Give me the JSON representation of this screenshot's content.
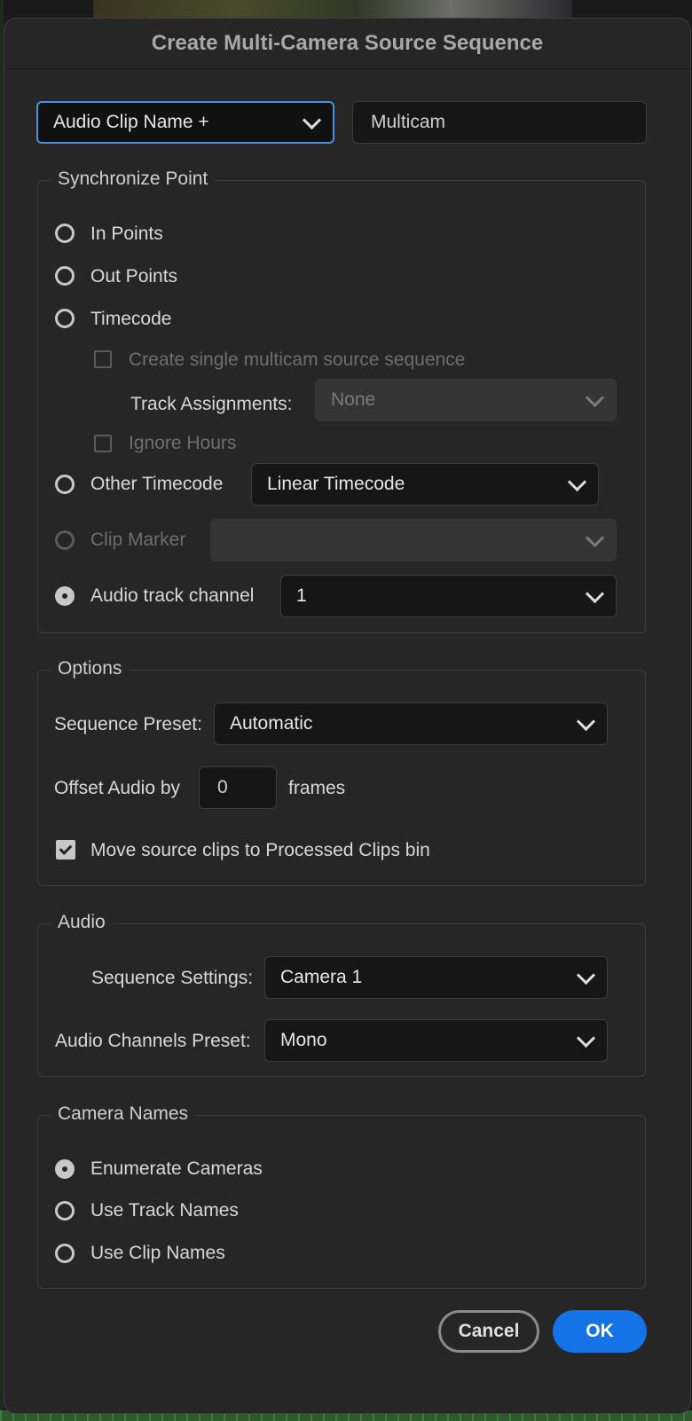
{
  "dialog": {
    "title": "Create Multi-Camera Source Sequence"
  },
  "header": {
    "name_mode_select": "Audio Clip Name +",
    "name_field": "Multicam"
  },
  "sync": {
    "legend": "Synchronize Point",
    "in_points": "In Points",
    "out_points": "Out Points",
    "timecode": "Timecode",
    "create_single": "Create single multicam source sequence",
    "track_assignments_label": "Track Assignments:",
    "track_assignments_value": "None",
    "ignore_hours": "Ignore Hours",
    "other_timecode": "Other Timecode",
    "other_timecode_value": "Linear Timecode",
    "clip_marker": "Clip Marker",
    "clip_marker_value": "",
    "audio_track_channel": "Audio track channel",
    "audio_track_channel_value": "1",
    "selected": "Audio track channel"
  },
  "options": {
    "legend": "Options",
    "sequence_preset_label": "Sequence Preset:",
    "sequence_preset_value": "Automatic",
    "offset_audio_label": "Offset Audio by",
    "offset_audio_value": "0",
    "frames_label": "frames",
    "move_clips_label": "Move source clips to Processed Clips bin",
    "move_clips_checked": true
  },
  "audio": {
    "legend": "Audio",
    "sequence_settings_label": "Sequence Settings:",
    "sequence_settings_value": "Camera 1",
    "channels_preset_label": "Audio Channels Preset:",
    "channels_preset_value": "Mono"
  },
  "camera_names": {
    "legend": "Camera Names",
    "enumerate": "Enumerate Cameras",
    "track_names": "Use Track Names",
    "clip_names": "Use Clip Names",
    "selected": "Enumerate Cameras"
  },
  "buttons": {
    "cancel": "Cancel",
    "ok": "OK"
  },
  "colors": {
    "accent": "#1473e6",
    "focus": "#4a90e2",
    "panel": "#262626"
  }
}
